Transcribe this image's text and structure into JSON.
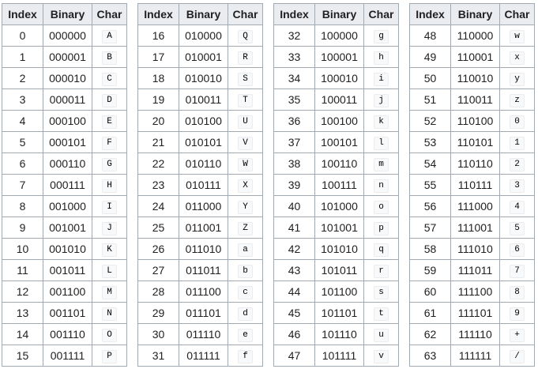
{
  "headers": {
    "index": "Index",
    "binary": "Binary",
    "char": "Char"
  },
  "groups": [
    {
      "rows": [
        {
          "index": "0",
          "binary": "000000",
          "char": "A"
        },
        {
          "index": "1",
          "binary": "000001",
          "char": "B"
        },
        {
          "index": "2",
          "binary": "000010",
          "char": "C"
        },
        {
          "index": "3",
          "binary": "000011",
          "char": "D"
        },
        {
          "index": "4",
          "binary": "000100",
          "char": "E"
        },
        {
          "index": "5",
          "binary": "000101",
          "char": "F"
        },
        {
          "index": "6",
          "binary": "000110",
          "char": "G"
        },
        {
          "index": "7",
          "binary": "000111",
          "char": "H"
        },
        {
          "index": "8",
          "binary": "001000",
          "char": "I"
        },
        {
          "index": "9",
          "binary": "001001",
          "char": "J"
        },
        {
          "index": "10",
          "binary": "001010",
          "char": "K"
        },
        {
          "index": "11",
          "binary": "001011",
          "char": "L"
        },
        {
          "index": "12",
          "binary": "001100",
          "char": "M"
        },
        {
          "index": "13",
          "binary": "001101",
          "char": "N"
        },
        {
          "index": "14",
          "binary": "001110",
          "char": "O"
        },
        {
          "index": "15",
          "binary": "001111",
          "char": "P"
        }
      ]
    },
    {
      "rows": [
        {
          "index": "16",
          "binary": "010000",
          "char": "Q"
        },
        {
          "index": "17",
          "binary": "010001",
          "char": "R"
        },
        {
          "index": "18",
          "binary": "010010",
          "char": "S"
        },
        {
          "index": "19",
          "binary": "010011",
          "char": "T"
        },
        {
          "index": "20",
          "binary": "010100",
          "char": "U"
        },
        {
          "index": "21",
          "binary": "010101",
          "char": "V"
        },
        {
          "index": "22",
          "binary": "010110",
          "char": "W"
        },
        {
          "index": "23",
          "binary": "010111",
          "char": "X"
        },
        {
          "index": "24",
          "binary": "011000",
          "char": "Y"
        },
        {
          "index": "25",
          "binary": "011001",
          "char": "Z"
        },
        {
          "index": "26",
          "binary": "011010",
          "char": "a"
        },
        {
          "index": "27",
          "binary": "011011",
          "char": "b"
        },
        {
          "index": "28",
          "binary": "011100",
          "char": "c"
        },
        {
          "index": "29",
          "binary": "011101",
          "char": "d"
        },
        {
          "index": "30",
          "binary": "011110",
          "char": "e"
        },
        {
          "index": "31",
          "binary": "011111",
          "char": "f"
        }
      ]
    },
    {
      "rows": [
        {
          "index": "32",
          "binary": "100000",
          "char": "g"
        },
        {
          "index": "33",
          "binary": "100001",
          "char": "h"
        },
        {
          "index": "34",
          "binary": "100010",
          "char": "i"
        },
        {
          "index": "35",
          "binary": "100011",
          "char": "j"
        },
        {
          "index": "36",
          "binary": "100100",
          "char": "k"
        },
        {
          "index": "37",
          "binary": "100101",
          "char": "l"
        },
        {
          "index": "38",
          "binary": "100110",
          "char": "m"
        },
        {
          "index": "39",
          "binary": "100111",
          "char": "n"
        },
        {
          "index": "40",
          "binary": "101000",
          "char": "o"
        },
        {
          "index": "41",
          "binary": "101001",
          "char": "p"
        },
        {
          "index": "42",
          "binary": "101010",
          "char": "q"
        },
        {
          "index": "43",
          "binary": "101011",
          "char": "r"
        },
        {
          "index": "44",
          "binary": "101100",
          "char": "s"
        },
        {
          "index": "45",
          "binary": "101101",
          "char": "t"
        },
        {
          "index": "46",
          "binary": "101110",
          "char": "u"
        },
        {
          "index": "47",
          "binary": "101111",
          "char": "v"
        }
      ]
    },
    {
      "rows": [
        {
          "index": "48",
          "binary": "110000",
          "char": "w"
        },
        {
          "index": "49",
          "binary": "110001",
          "char": "x"
        },
        {
          "index": "50",
          "binary": "110010",
          "char": "y"
        },
        {
          "index": "51",
          "binary": "110011",
          "char": "z"
        },
        {
          "index": "52",
          "binary": "110100",
          "char": "0"
        },
        {
          "index": "53",
          "binary": "110101",
          "char": "1"
        },
        {
          "index": "54",
          "binary": "110110",
          "char": "2"
        },
        {
          "index": "55",
          "binary": "110111",
          "char": "3"
        },
        {
          "index": "56",
          "binary": "111000",
          "char": "4"
        },
        {
          "index": "57",
          "binary": "111001",
          "char": "5"
        },
        {
          "index": "58",
          "binary": "111010",
          "char": "6"
        },
        {
          "index": "59",
          "binary": "111011",
          "char": "7"
        },
        {
          "index": "60",
          "binary": "111100",
          "char": "8"
        },
        {
          "index": "61",
          "binary": "111101",
          "char": "9"
        },
        {
          "index": "62",
          "binary": "111110",
          "char": "+"
        },
        {
          "index": "63",
          "binary": "111111",
          "char": "/"
        }
      ]
    }
  ]
}
